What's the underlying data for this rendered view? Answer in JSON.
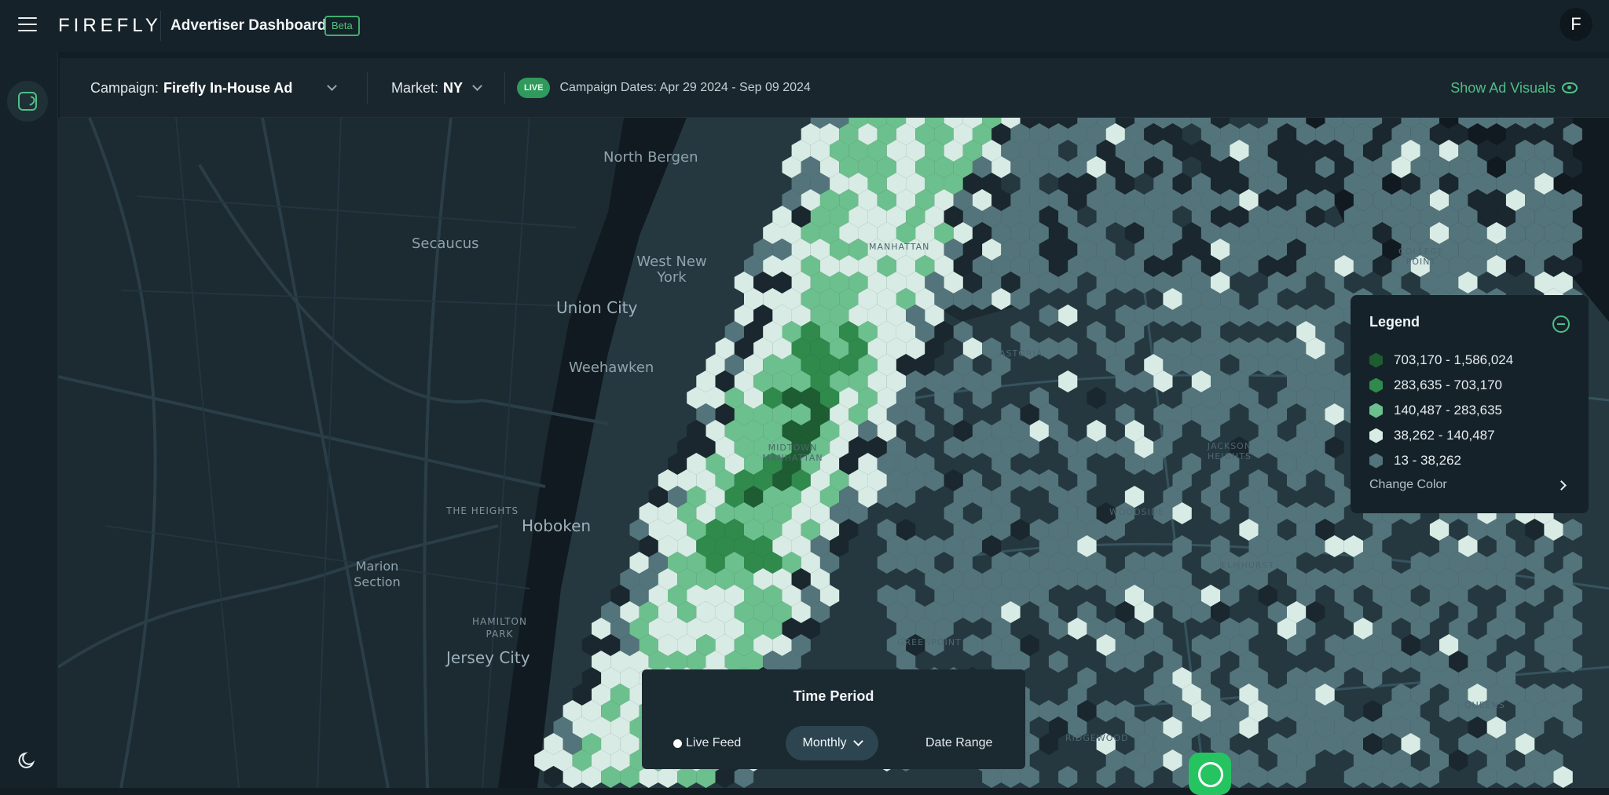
{
  "header": {
    "logo": "FIREFLY",
    "title": "Advertiser Dashboard",
    "badge": "Beta",
    "avatar_initial": "F"
  },
  "filters": {
    "campaign_label": "Campaign:",
    "campaign_value": "Firefly In-House Ad",
    "market_label": "Market:",
    "market_value": "NY",
    "status_badge": "LIVE",
    "campaign_dates": "Campaign Dates: Apr 29 2024 - Sep 09 2024",
    "show_visuals": "Show Ad Visuals"
  },
  "map": {
    "labels": {
      "north_bergen": "North Bergen",
      "secaucus": "Secaucus",
      "west_new_york": "West New York",
      "union_city": "Union City",
      "weehawken": "Weehawken",
      "the_heights": "THE HEIGHTS",
      "hoboken": "Hoboken",
      "marion_section": "Marion Section",
      "hamilton_park": "HAMILTON PARK",
      "jersey_city": "Jersey City",
      "manhattan": "MANHATTAN",
      "midtown": "MIDTOWN MANHATTAN",
      "astoria": "ASTORIA",
      "jackson_heights": "JACKSON HEIGHTS",
      "woodside": "WOODSIDE",
      "elmhurst": "ELMHURST",
      "greenpoint": "GREENPOINT",
      "ridgewood": "RIDGEWOOD",
      "college_point": "COLLEGE POINT",
      "queens": "QUEENS"
    },
    "controls": {
      "expand": "expand-icon",
      "zoom_in": "+",
      "zoom_out": "−",
      "reset": "reset-icon"
    }
  },
  "legend": {
    "title": "Legend",
    "items": [
      {
        "range": "703,170 - 1,586,024",
        "color": "#1e5c32"
      },
      {
        "range": "283,635 - 703,170",
        "color": "#2f8a4c"
      },
      {
        "range": "140,487 - 283,635",
        "color": "#6cc08d"
      },
      {
        "range": "38,262 - 140,487",
        "color": "#d8ebe4"
      },
      {
        "range": "13 - 38,262",
        "color": "#54747c"
      }
    ],
    "change_color": "Change Color"
  },
  "time_period": {
    "title": "Time Period",
    "live_feed": "Live Feed",
    "monthly": "Monthly",
    "date_range": "Date Range"
  }
}
